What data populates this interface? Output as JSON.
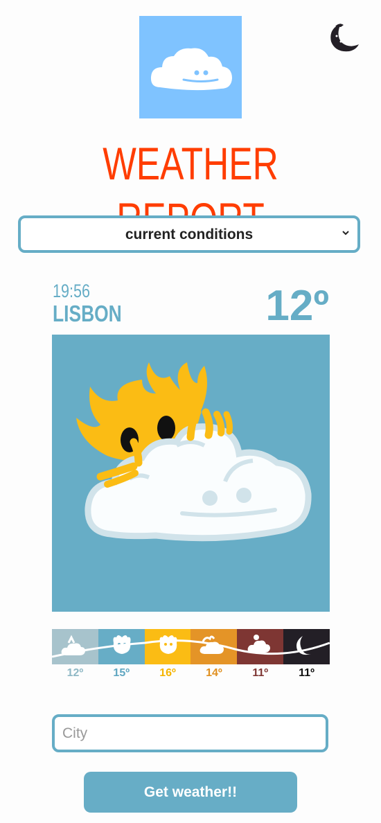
{
  "header": {
    "logo_icon": "happy-cloud-icon",
    "theme_toggle_icon": "crescent-moon-icon",
    "title": "WEATHER REPORT"
  },
  "mode_select": {
    "selected": "current conditions"
  },
  "current": {
    "time": "19:56",
    "city": "LISBON",
    "temperature": "12º",
    "illustration_icon": "sun-behind-cloud-icon"
  },
  "forecast": [
    {
      "icon": "cloudy-icon",
      "temp": "12º",
      "color": "#a7c3cc",
      "text_color": "#8fb8c5"
    },
    {
      "icon": "sun-icon",
      "temp": "15º",
      "color": "#67adc6",
      "text_color": "#5fa6c1"
    },
    {
      "icon": "sun-icon",
      "temp": "16º",
      "color": "#fbbc14",
      "text_color": "#f5b400"
    },
    {
      "icon": "sun-cloud-icon",
      "temp": "14º",
      "color": "#e49427",
      "text_color": "#e09020"
    },
    {
      "icon": "sunset-cloud-icon",
      "temp": "11º",
      "color": "#7e3633",
      "text_color": "#7e3633"
    },
    {
      "icon": "moon-icon",
      "temp": "11º",
      "color": "#231f26",
      "text_color": "#111"
    }
  ],
  "search": {
    "placeholder": "City",
    "button_label": "Get weather!!"
  },
  "colors": {
    "accent": "#66adc6",
    "title": "#ff3d00",
    "sun": "#fbbc14"
  }
}
